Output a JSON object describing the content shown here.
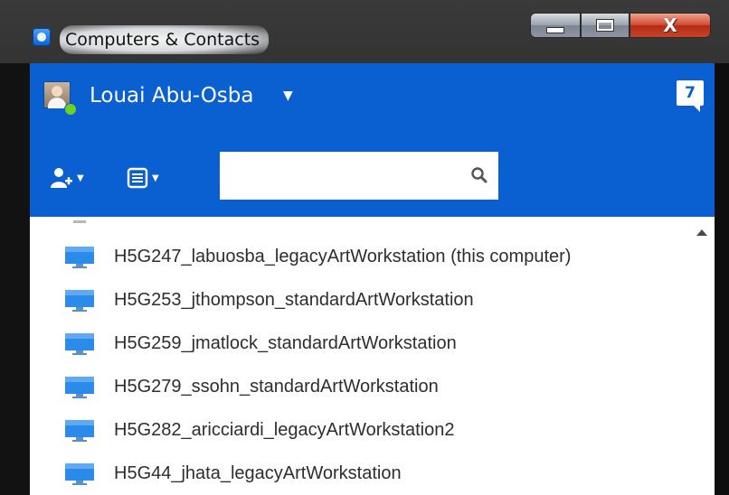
{
  "window": {
    "title": "Computers & Contacts",
    "controls": {
      "minimize": "minimize",
      "maximize": "maximize",
      "close": "X"
    }
  },
  "header": {
    "user_name": "Louai Abu-Osba",
    "user_caret": "▼",
    "status_color": "#6fd21c",
    "notification_count": "7",
    "accent_color": "#0a5fd1"
  },
  "toolbar": {
    "add_contact_caret": "▼",
    "view_menu_caret": "▼",
    "search": {
      "value": "",
      "placeholder": ""
    }
  },
  "computers": [
    {
      "label": "H5G247_labuosba_legacyArtWorkstation (this computer)"
    },
    {
      "label": "H5G253_jthompson_standardArtWorkstation"
    },
    {
      "label": "H5G259_jmatlock_standardArtWorkstation"
    },
    {
      "label": "H5G279_ssohn_standardArtWorkstation"
    },
    {
      "label": "H5G282_aricciardi_legacyArtWorkstation2"
    },
    {
      "label": "H5G44_jhata_legacyArtWorkstation"
    }
  ]
}
